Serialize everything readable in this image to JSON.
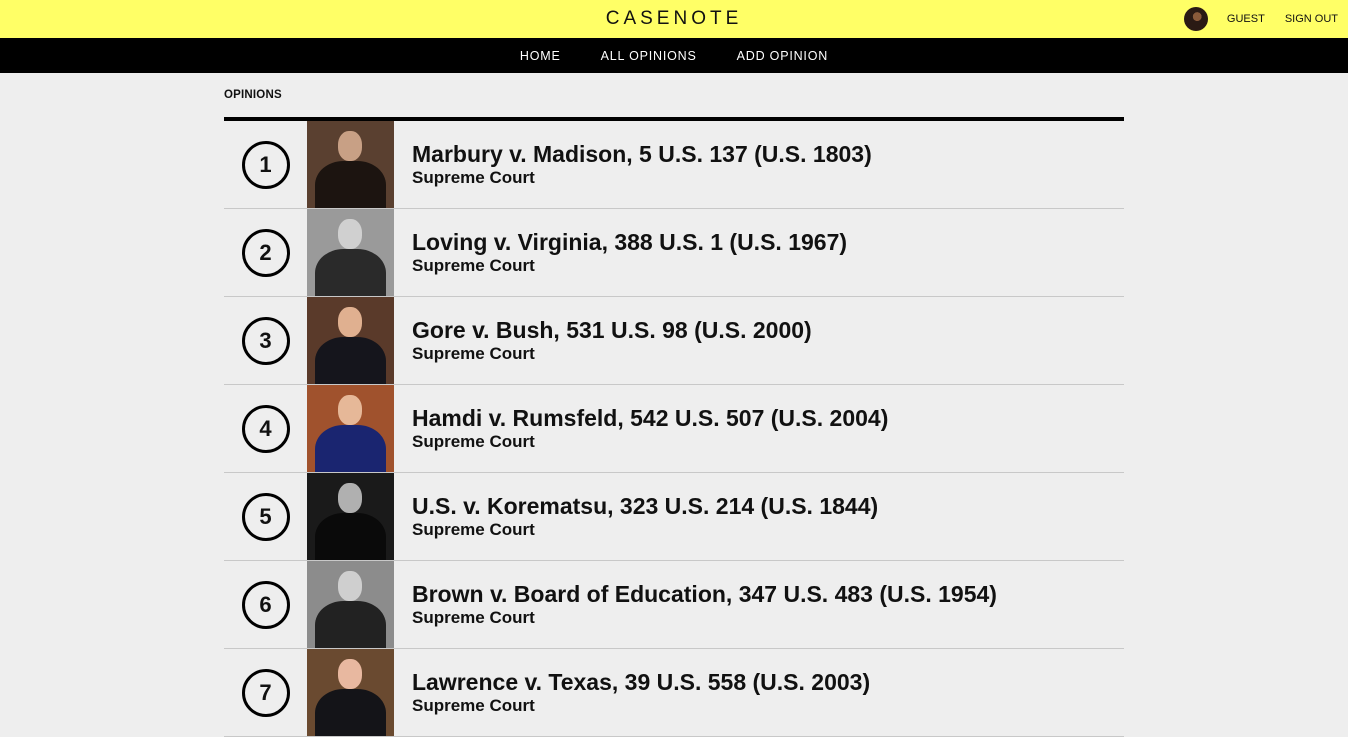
{
  "header": {
    "logo": "CASENOTE",
    "user_label": "GUEST",
    "signout_label": "SIGN OUT"
  },
  "nav": {
    "items": [
      "HOME",
      "ALL OPINIONS",
      "ADD OPINION"
    ]
  },
  "main": {
    "section_title": "OPINIONS",
    "opinions": [
      {
        "rank": "1",
        "title": "Marbury v. Madison, 5 U.S. 137 (U.S. 1803)",
        "court": "Supreme Court",
        "bg": "#5a4030",
        "head": "#c8a085",
        "body": "#1c1410"
      },
      {
        "rank": "2",
        "title": "Loving v. Virginia, 388 U.S. 1 (U.S. 1967)",
        "court": "Supreme Court",
        "bg": "#9a9a9a",
        "head": "#d0d0d0",
        "body": "#2a2a2a"
      },
      {
        "rank": "3",
        "title": "Gore v. Bush, 531 U.S. 98 (U.S. 2000)",
        "court": "Supreme Court",
        "bg": "#5a3a2a",
        "head": "#e0b090",
        "body": "#15151c"
      },
      {
        "rank": "4",
        "title": "Hamdi v. Rumsfeld, 542 U.S. 507 (U.S. 2004)",
        "court": "Supreme Court",
        "bg": "#a0522d",
        "head": "#e6b898",
        "body": "#1a2570"
      },
      {
        "rank": "5",
        "title": "U.S. v. Korematsu, 323 U.S. 214 (U.S. 1844)",
        "court": "Supreme Court",
        "bg": "#1a1a1a",
        "head": "#b0b0b0",
        "body": "#0a0a0a"
      },
      {
        "rank": "6",
        "title": "Brown v. Board of Education, 347 U.S. 483 (U.S. 1954)",
        "court": "Supreme Court",
        "bg": "#8c8c8c",
        "head": "#cfcfcf",
        "body": "#222222"
      },
      {
        "rank": "7",
        "title": "Lawrence v. Texas, 39 U.S. 558 (U.S. 2003)",
        "court": "Supreme Court",
        "bg": "#6a4a30",
        "head": "#e8b8a0",
        "body": "#141418"
      }
    ]
  }
}
